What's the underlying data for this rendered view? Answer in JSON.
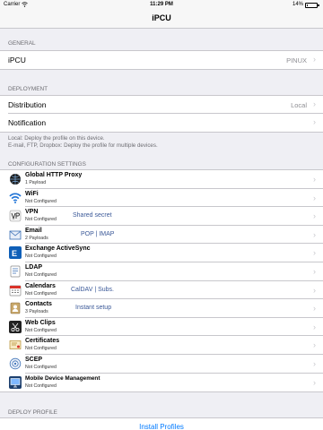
{
  "status_bar": {
    "carrier": "Carrier",
    "time": "11:29 PM",
    "battery": "14%"
  },
  "nav": {
    "title": "iPCU"
  },
  "general": {
    "header": "GENERAL",
    "row": {
      "label": "iPCU",
      "value": "PINUX"
    }
  },
  "deployment": {
    "header": "DEPLOYMENT",
    "rows": [
      {
        "label": "Distribution",
        "value": "Local"
      },
      {
        "label": "Notification",
        "value": ""
      }
    ],
    "footer_lines": [
      "Local: Deploy the profile on this device.",
      "E-mail, FTP, Dropbox: Deploy the profile for multiple devices."
    ]
  },
  "config": {
    "header": "CONFIGURATION SETTINGS",
    "items": [
      {
        "title": "Global HTTP Proxy",
        "subtitle": "1 Payload",
        "hint": "",
        "icon": "proxy-icon"
      },
      {
        "title": "WiFi",
        "subtitle": "Not Configured",
        "hint": "",
        "icon": "wifi-icon"
      },
      {
        "title": "VPN",
        "subtitle": "Not Configured",
        "hint": "Shared secret",
        "icon": "vpn-icon"
      },
      {
        "title": "Email",
        "subtitle": "2 Payloads",
        "hint": "POP | IMAP",
        "icon": "email-icon"
      },
      {
        "title": "Exchange ActiveSync",
        "subtitle": "Not Configured",
        "hint": "",
        "icon": "exchange-icon"
      },
      {
        "title": "LDAP",
        "subtitle": "Not Configured",
        "hint": "",
        "icon": "ldap-icon"
      },
      {
        "title": "Calendars",
        "subtitle": "Not Configured",
        "hint": "CalDAV | Subs.",
        "icon": "calendar-icon"
      },
      {
        "title": "Contacts",
        "subtitle": "3 Payloads",
        "hint": "Instant setup",
        "icon": "contacts-icon"
      },
      {
        "title": "Web Clips",
        "subtitle": "Not Configured",
        "hint": "",
        "icon": "webclips-icon"
      },
      {
        "title": "Certificates",
        "subtitle": "Not Configured",
        "hint": "",
        "icon": "certificate-icon"
      },
      {
        "title": "SCEP",
        "subtitle": "Not Configured",
        "hint": "",
        "icon": "scep-icon"
      },
      {
        "title": "Mobile Device Management",
        "subtitle": "Not Configured",
        "hint": "",
        "icon": "mdm-icon"
      }
    ]
  },
  "deploy": {
    "header": "DEPLOY PROFILE",
    "button": "Install Profiles"
  },
  "colors": {
    "link": "#007aff",
    "hint": "#3b5998",
    "background": "#efeff4"
  }
}
